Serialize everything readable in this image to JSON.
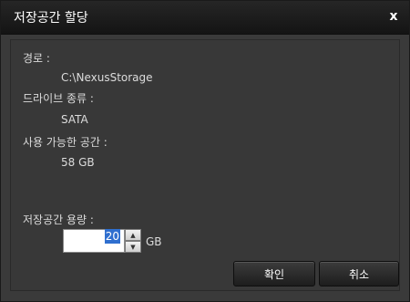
{
  "dialog": {
    "title": "저장공간 할당",
    "close_glyph": "x"
  },
  "fields": {
    "path_label": "경로 :",
    "path_value": "C:\\NexusStorage",
    "drive_type_label": "드라이브 종류 :",
    "drive_type_value": "SATA",
    "available_label": "사용 가능한 공간 :",
    "available_value": "58 GB",
    "capacity_label": "저장공간 용량 :",
    "capacity_value": "20",
    "capacity_unit": "GB"
  },
  "buttons": {
    "ok_label": "확인",
    "cancel_label": "취소"
  },
  "icons": {
    "spin_up": "chevron-up-icon",
    "spin_down": "chevron-down-icon",
    "close": "close-icon"
  }
}
